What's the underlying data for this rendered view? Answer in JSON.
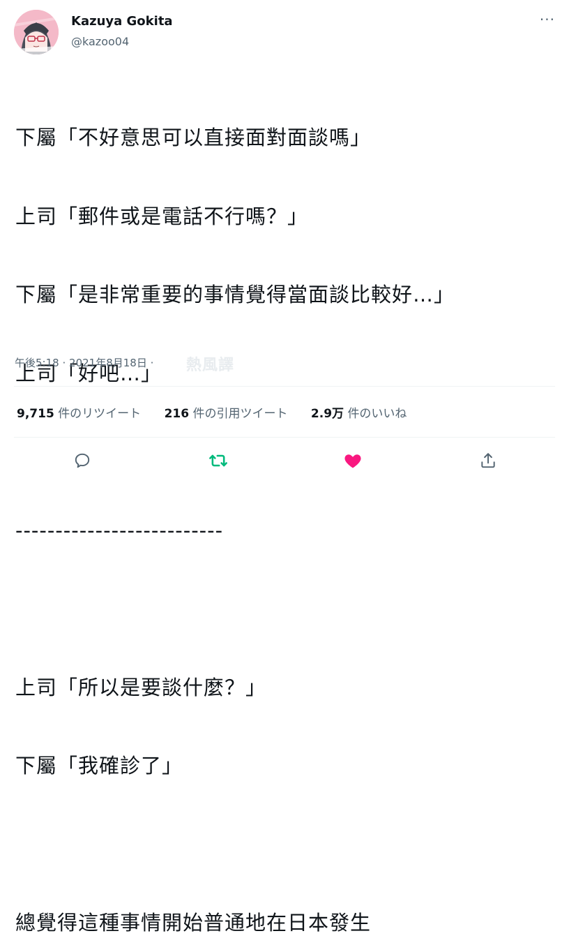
{
  "author": {
    "name": "Kazuya Gokita",
    "handle": "@kazoo04",
    "avatar_icon": "avatar-anime-glasses"
  },
  "more_icon": "more-horizontal-icon",
  "more_glyph": "···",
  "tweet_lines": [
    "下屬「不好意思可以直接面對面談嗎」",
    "上司「郵件或是電話不行嗎？」",
    "下屬「是非常重要的事情覺得當面談比較好…」",
    "上司「好吧…」",
    "",
    "--------------------------",
    "",
    "上司「所以是要談什麼？」",
    "下屬「我確診了」",
    "",
    "總覺得這種事情開始普通地在日本發生"
  ],
  "meta": {
    "time": "午後5:18",
    "separator": "·",
    "date": "2021年8月18日",
    "separator2": "·"
  },
  "watermark": "熱風譯",
  "stats": {
    "retweets_count": "9,715",
    "retweets_label": "件のリツイート",
    "quotes_count": "216",
    "quotes_label": "件の引用ツイート",
    "likes_count": "2.9万",
    "likes_label": "件のいいね"
  },
  "colors": {
    "text": "#0f1419",
    "secondary": "#536471",
    "retweet_green": "#00ba7c",
    "like_pink": "#f91880",
    "divider": "#eff3f4"
  }
}
